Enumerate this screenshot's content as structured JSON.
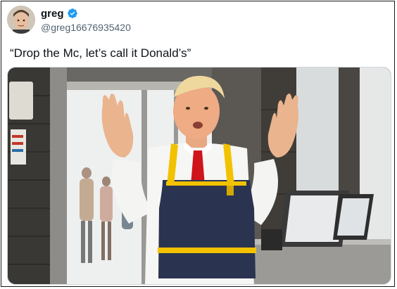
{
  "author": {
    "display_name": "greg",
    "handle": "@greg16676935420",
    "verified": true,
    "verified_icon": "verified-badge-icon",
    "verified_color": "#1d9bf0"
  },
  "tweet": {
    "text": "“Drop the Mc, let’s call it Donald’s”"
  },
  "media": {
    "type": "photo",
    "apron_color": "#2a3450",
    "apron_trim_color": "#f2c200",
    "tie_color": "#d0141c"
  }
}
